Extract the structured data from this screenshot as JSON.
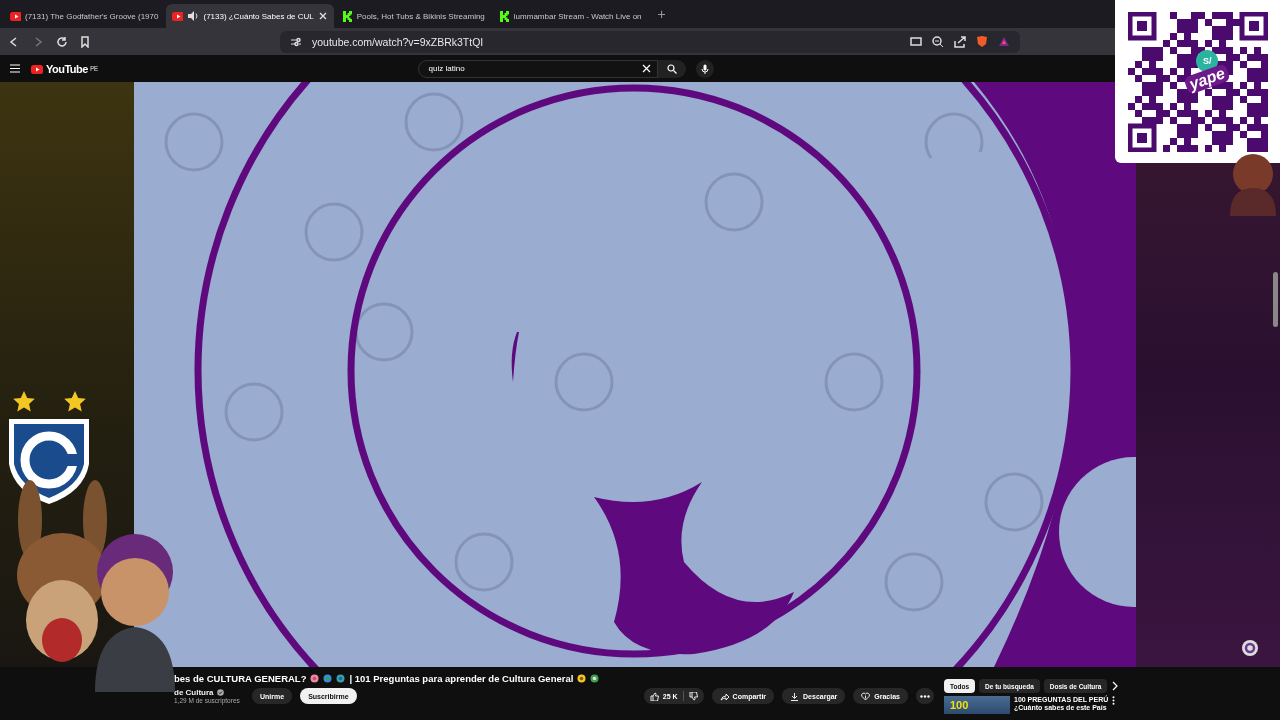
{
  "browser": {
    "tabs": [
      {
        "title": "(7131) The Godfather's Groove (1970",
        "kind": "youtube",
        "selected": false,
        "audio": false
      },
      {
        "title": "(7133) ¿Cuánto Sabes de CUL",
        "kind": "youtube",
        "selected": true,
        "audio": true
      },
      {
        "title": "Pools, Hot Tubs & Bikinis Streaming",
        "kind": "kick",
        "selected": false,
        "audio": false
      },
      {
        "title": "lummambar Stream - Watch Live on",
        "kind": "kick",
        "selected": false,
        "audio": false
      }
    ],
    "new_tab": "+",
    "url": "youtube.com/watch?v=9xZBRk3TtQI"
  },
  "youtube": {
    "logo": "YouTube",
    "region": "PE",
    "search": {
      "value": "quiz latino"
    }
  },
  "overlay": {
    "qr_badge": "S/",
    "qr_brand": "yape"
  },
  "video": {
    "title_start": "bes de CULTURA GENERAL?",
    "title_end": "| 101 Preguntas para aprender de Cultura General",
    "channel": "de Cultura",
    "verified": true,
    "subscribers": "1,29 M de suscriptores",
    "join": "Unirme",
    "subscribe": "Suscribirme",
    "likes": "25 K",
    "actions": [
      {
        "kind": "share",
        "label": "Compartir"
      },
      {
        "kind": "download",
        "label": "Descargar"
      },
      {
        "kind": "thanks",
        "label": "Gracias"
      }
    ]
  },
  "related": {
    "chips": [
      {
        "label": "Todos",
        "selected": true
      },
      {
        "label": "De tu búsqueda",
        "selected": false
      },
      {
        "label": "Dosis de Cultura",
        "selected": false
      }
    ],
    "items": [
      {
        "thumb_text": "100",
        "title": "100 PREGUNTAS DEL PERÚ",
        "subtitle": "¿Cuánto sabes de este País"
      }
    ]
  }
}
